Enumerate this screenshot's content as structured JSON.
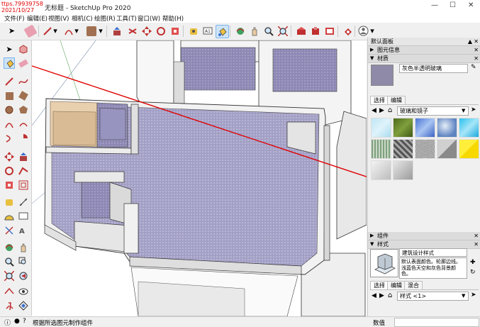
{
  "window": {
    "title": "无标题 - SketchUp Pro 2020"
  },
  "watermark": {
    "line1": "ttps.79939758",
    "line2": "2021/10/27"
  },
  "menu": [
    "文件(F)",
    "编辑(E)",
    "视图(V)",
    "相机(C)",
    "绘图(R)",
    "工具(T)",
    "窗口(W)",
    "帮助(H)"
  ],
  "tray": {
    "title": "默认面板",
    "entity_info": {
      "label": "图元信息"
    },
    "materials": {
      "label": "材质",
      "current_name": "灰色半透明玻璃",
      "tab_select": "选择",
      "tab_edit": "编辑",
      "collection": "玻璃和镜子"
    },
    "components": {
      "label": "组件"
    },
    "styles": {
      "label": "样式",
      "name": "建筑设计样式",
      "description": "默认表面颜色。轮廓边线。浅蓝色天空和灰色背景颜色。",
      "tab_select": "选择",
      "tab_edit": "编辑",
      "tab_mix": "混合",
      "collection": "样式 <1>"
    }
  },
  "status": {
    "hint": "根据所选图元制作组件",
    "measurements_label": "数值"
  },
  "colors": {
    "accent_red": "#e00000",
    "selection_blue": "#0078d7",
    "room_floor": "#a29fc4"
  }
}
